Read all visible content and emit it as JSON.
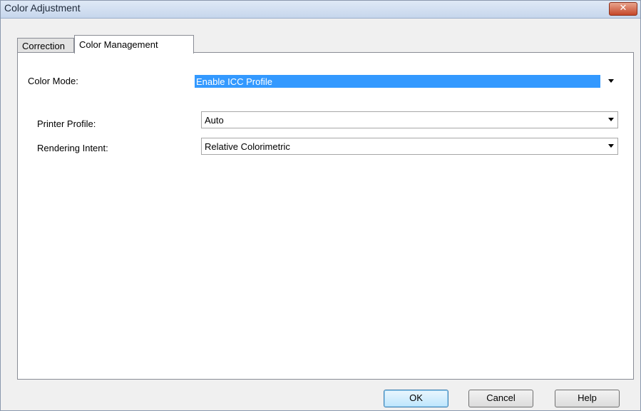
{
  "window": {
    "title": "Color Adjustment",
    "close_label": "✕"
  },
  "tabs": [
    {
      "label": "Correction"
    },
    {
      "label": "Color Management"
    }
  ],
  "color_mode": {
    "label": "Color Mode:",
    "value": "Enable ICC Profile"
  },
  "printer_profile": {
    "label": "Printer Profile:",
    "value": "Auto"
  },
  "rendering_intent": {
    "label": "Rendering Intent:",
    "value": "Relative Colorimetric"
  },
  "buttons": {
    "ok": "OK",
    "cancel": "Cancel",
    "help": "Help"
  },
  "colors": {
    "selection": "#3399ff",
    "title_bar": "#c6d6ec",
    "close": "#c5472a"
  }
}
